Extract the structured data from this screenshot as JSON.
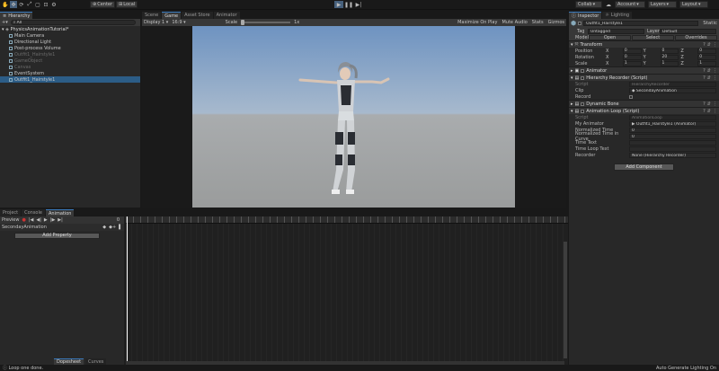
{
  "toolbar": {
    "center": "Center",
    "local": "Local",
    "collab": "Collab",
    "account": "Account",
    "layers": "Layers",
    "layout": "Layout"
  },
  "hierarchy": {
    "tab": "Hierarchy",
    "search_placeholder": "All",
    "scene": "PhysicsAnimationTutorial*",
    "items": [
      {
        "label": "Main Camera",
        "dim": false
      },
      {
        "label": "Directional Light",
        "dim": false
      },
      {
        "label": "Post-process Volume",
        "dim": false
      },
      {
        "label": "Outfit1_Hairstyle1",
        "dim": true
      },
      {
        "label": "GameObject",
        "dim": true
      },
      {
        "label": "Canvas",
        "dim": true
      },
      {
        "label": "EventSystem",
        "dim": false
      },
      {
        "label": "Outfit1_Hairstyle1",
        "dim": false,
        "selected": true
      }
    ]
  },
  "scene_tabs": [
    "Scene",
    "Game",
    "Asset Store",
    "Animator"
  ],
  "game_bar": {
    "display": "Display 1",
    "aspect": "16:9",
    "scale_label": "Scale",
    "scale_value": "1x",
    "maximize": "Maximize On Play",
    "mute": "Mute Audio",
    "stats": "Stats",
    "gizmos": "Gizmos"
  },
  "bottom_tabs": [
    "Project",
    "Console",
    "Animation"
  ],
  "animation": {
    "preview": "Preview",
    "frame": "0",
    "clip": "SecondayAnimation",
    "add_property": "Add Property",
    "dopesheet": "Dopesheet",
    "curves": "Curves"
  },
  "inspector": {
    "tabs": [
      "Inspector",
      "Lighting"
    ],
    "object_name": "Outfit1_Hairstyle1",
    "static": "Static",
    "tag_label": "Tag",
    "tag": "Untagged",
    "layer_label": "Layer",
    "layer": "Default",
    "model_label": "Model",
    "open": "Open",
    "select": "Select",
    "overrides": "Overrides",
    "transform": {
      "title": "Transform",
      "position": {
        "label": "Position",
        "x": "0",
        "y": "0",
        "z": "0"
      },
      "rotation": {
        "label": "Rotation",
        "x": "0",
        "y": "20",
        "z": "0"
      },
      "scale": {
        "label": "Scale",
        "x": "1",
        "y": "1",
        "z": "1"
      }
    },
    "animator_title": "Animator",
    "recorder": {
      "title": "Hierarchy Recorder (Script)",
      "script_label": "Script",
      "script": "HierarchyRecorder",
      "clip_label": "Clip",
      "clip": "SecondayAnimation",
      "record_label": "Record"
    },
    "dynamic_bone": "Dynamic Bone",
    "loop": {
      "title": "Animation Loop (Script)",
      "script_label": "Script",
      "script": "AnimationLoop",
      "my_animator_label": "My Animator",
      "my_animator": "Outfit1_Hairstyle1 (Animator)",
      "norm_time_label": "Normalized Time",
      "norm_time": "0",
      "norm_curve_label": "Normalized Time in Curve",
      "norm_curve": "0",
      "time_text_label": "Time Text",
      "time_loop_label": "Time Loop Text",
      "recorder_label": "Recorder",
      "recorder": "None (Hierarchy Recorder)"
    },
    "add_component": "Add Component"
  },
  "status": {
    "left": "Loop one done.",
    "right": "Auto Generate Lighting On"
  }
}
